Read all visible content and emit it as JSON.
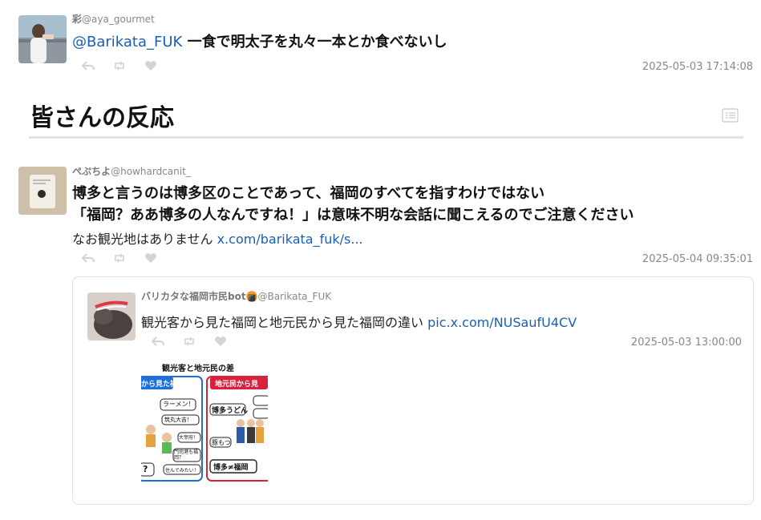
{
  "tweet1": {
    "name": "彩",
    "handle": "@aya_gourmet",
    "mention": "@Barikata_FUK",
    "text": " 一食で明太子を丸々一本とか食べないし",
    "timestamp": "2025-05-03 17:14:08"
  },
  "section": {
    "title": "皆さんの反応",
    "icon": "list-icon"
  },
  "tweet2": {
    "name": "ぺぷちよ",
    "handle": "@howhardcanit_",
    "line1": "博多と言うのは博多区のことであって、福岡のすべてを指すわけではない",
    "line2": "「福岡？ああ博多の人なんですね！」は意味不明な会話に聞こえるのでご注意ください",
    "line3": "なお観光地はありません",
    "link": "x.com/barikata_fuk/s...",
    "timestamp": "2025-05-04 09:35:01"
  },
  "quote": {
    "name": "バリカタな福岡市民bot",
    "emoji": "🍘",
    "handle": "@Barikata_FUK",
    "text": "観光客から見た福岡と地元民から見た福岡の違い",
    "link": "pic.x.com/NUSaufU4CV",
    "timestamp": "2025-05-03 13:00:00",
    "image": {
      "title": "観光客と地元民の差",
      "left_header": "から見た福岡",
      "right_header": "地元民から見",
      "bubbles_left": [
        "ラーメン！",
        "中洲",
        "筑丸大吉！",
        "大宰府！",
        "門司港も福岡？",
        "住んでみたい！",
        "?"
      ],
      "bubbles_right": [
        "博多うどん",
        "コン",
        "北九",
        "ドー",
        "豚もつ",
        "博多≠福岡"
      ]
    }
  },
  "colors": {
    "link": "#1a5fb4",
    "muted": "#888888",
    "divider": "#e0e0e0",
    "tourist_blue": "#1e6fd9",
    "local_red": "#d8213b"
  }
}
